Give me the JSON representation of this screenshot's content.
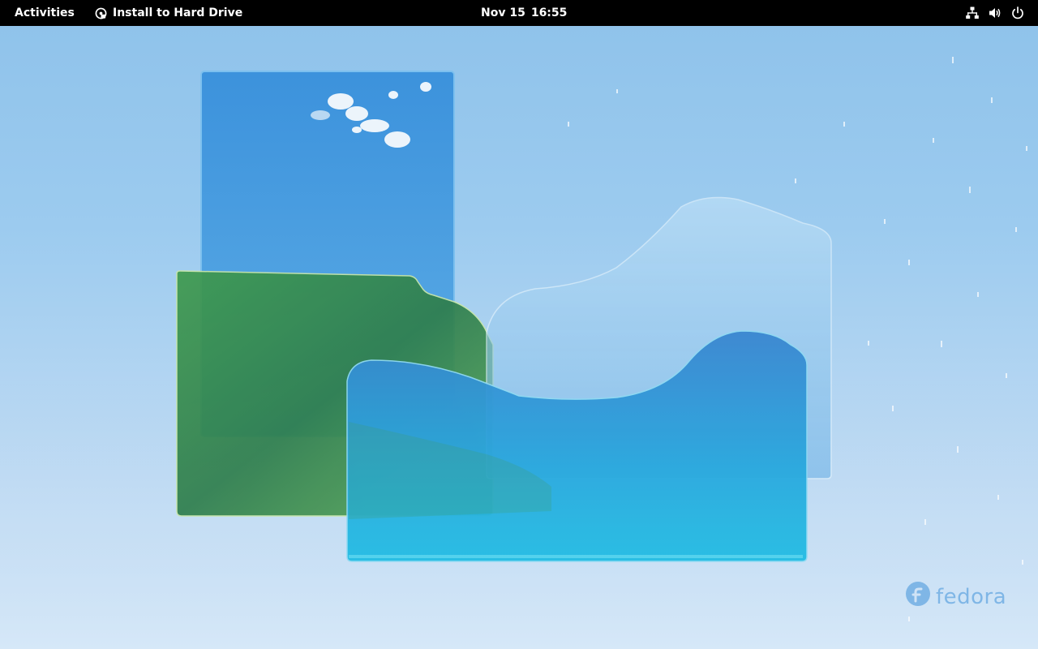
{
  "topbar": {
    "activities_label": "Activities",
    "app_menu": {
      "icon": "disk-installer-icon",
      "label": "Install to Hard Drive"
    },
    "clock": {
      "date": "Nov 15",
      "time": "16:55"
    },
    "status_icons": [
      "network-icon",
      "volume-icon",
      "power-icon"
    ]
  },
  "desktop": {
    "wallpaper": "fedora-glass-shapes-wallpaper",
    "watermark": {
      "icon": "fedora-logo-icon",
      "text": "fedora"
    }
  },
  "colors": {
    "topbar_bg": "#000000",
    "topbar_text": "#ffffff",
    "sky_blue": "#8ec2ea",
    "glass_blue": "#3d97dc",
    "glass_green": "#3a8a55",
    "glass_cyan": "#27b5e0",
    "fedora_watermark": "#7fb6e6"
  }
}
